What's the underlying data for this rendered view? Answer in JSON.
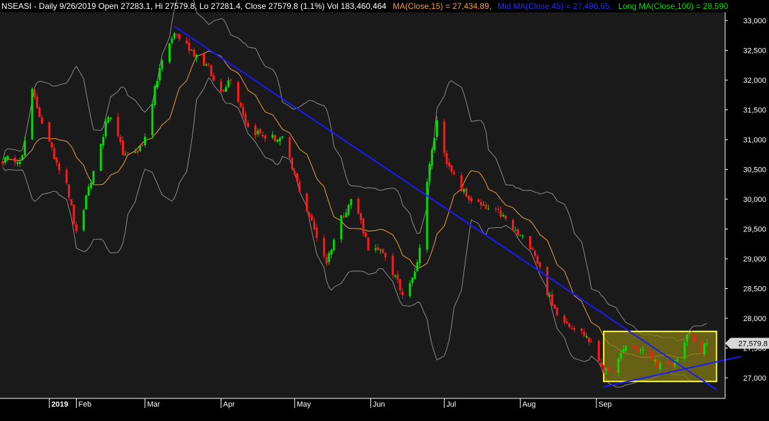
{
  "header": {
    "symbol_info": "NSEASI - Daily 9/26/2019 Open 27283.1, Hi 27579.8, Lo 27281.4, Close 27579.8 (1.1%) Vol 183,460,464",
    "ma15": "MA(Close,15) = 27,434.89,",
    "ma45": "Mid MA(Close,45) = 27,496.65,",
    "ma100": "Long MA(Close,100) = 28,590"
  },
  "colors": {
    "background": "#000000",
    "plot_background": "#1a1a1a",
    "up_candle": "#00e000",
    "down_candle": "#ff1a1a",
    "ma15": "#f0a040",
    "bands": "#8c8c8c",
    "trendline": "#1a1aff",
    "box_fill": "#807a14",
    "box_stroke": "#ffff30",
    "axis_text": "#ffffff",
    "price_tag_bg": "#d9d9d9"
  },
  "chart_data": {
    "type": "candlestick",
    "title": "",
    "ylim": [
      26700,
      33150
    ],
    "y_ticks": [
      "33,000",
      "32,500",
      "32,000",
      "31,500",
      "31,000",
      "30,500",
      "30,000",
      "29,500",
      "29,000",
      "28,500",
      "28,000",
      "27,500",
      "27,000"
    ],
    "x_tick_labels": [
      "2019",
      "Feb",
      "Mar",
      "Apr",
      "May",
      "Jun",
      "Jul",
      "Aug",
      "Sep"
    ],
    "last_price_label": "27,579.8",
    "last_price": 27579.8,
    "grid": false,
    "anchors": [
      [
        "2019-01-02",
        30650
      ],
      [
        "2019-01-10",
        30700
      ],
      [
        "2019-01-14",
        31800
      ],
      [
        "2019-01-22",
        30800
      ],
      [
        "2019-01-28",
        30300
      ],
      [
        "2019-02-01",
        29400
      ],
      [
        "2019-02-07",
        30300
      ],
      [
        "2019-02-14",
        31400
      ],
      [
        "2019-02-21",
        30700
      ],
      [
        "2019-02-28",
        30900
      ],
      [
        "2019-03-07",
        32200
      ],
      [
        "2019-03-13",
        32800
      ],
      [
        "2019-03-20",
        32500
      ],
      [
        "2019-03-27",
        32200
      ],
      [
        "2019-03-31",
        31750
      ],
      [
        "2019-04-05",
        32050
      ],
      [
        "2019-04-12",
        31200
      ],
      [
        "2019-04-19",
        31050
      ],
      [
        "2019-04-26",
        31000
      ],
      [
        "2019-04-30",
        30500
      ],
      [
        "2019-05-08",
        29600
      ],
      [
        "2019-05-14",
        28950
      ],
      [
        "2019-05-20",
        29700
      ],
      [
        "2019-05-25",
        30050
      ],
      [
        "2019-05-31",
        29200
      ],
      [
        "2019-06-07",
        29050
      ],
      [
        "2019-06-14",
        28400
      ],
      [
        "2019-06-20",
        28900
      ],
      [
        "2019-06-24",
        30300
      ],
      [
        "2019-06-28",
        31300
      ],
      [
        "2019-07-03",
        30500
      ],
      [
        "2019-07-10",
        30050
      ],
      [
        "2019-07-17",
        29850
      ],
      [
        "2019-07-24",
        29750
      ],
      [
        "2019-07-31",
        29400
      ],
      [
        "2019-08-06",
        29200
      ],
      [
        "2019-08-14",
        28200
      ],
      [
        "2019-08-21",
        27900
      ],
      [
        "2019-08-28",
        27700
      ],
      [
        "2019-09-04",
        27150
      ],
      [
        "2019-09-07",
        27000
      ],
      [
        "2019-09-13",
        27550
      ],
      [
        "2019-09-20",
        27450
      ],
      [
        "2019-09-27",
        27200
      ],
      [
        "2019-10-02",
        27200
      ],
      [
        "2019-10-09",
        27750
      ],
      [
        "2019-10-14",
        27450
      ],
      [
        "2019-10-16",
        27580
      ]
    ],
    "trendlines": [
      {
        "from": [
          "2019-03-13",
          32900
        ],
        "to": [
          "2019-10-20",
          26800
        ]
      },
      {
        "from": [
          "2019-09-04",
          26850
        ],
        "to": [
          "2019-10-30",
          27360
        ]
      }
    ],
    "rectangle": {
      "from": [
        "2019-09-04",
        27780
      ],
      "to": [
        "2019-10-20",
        26940
      ]
    }
  }
}
